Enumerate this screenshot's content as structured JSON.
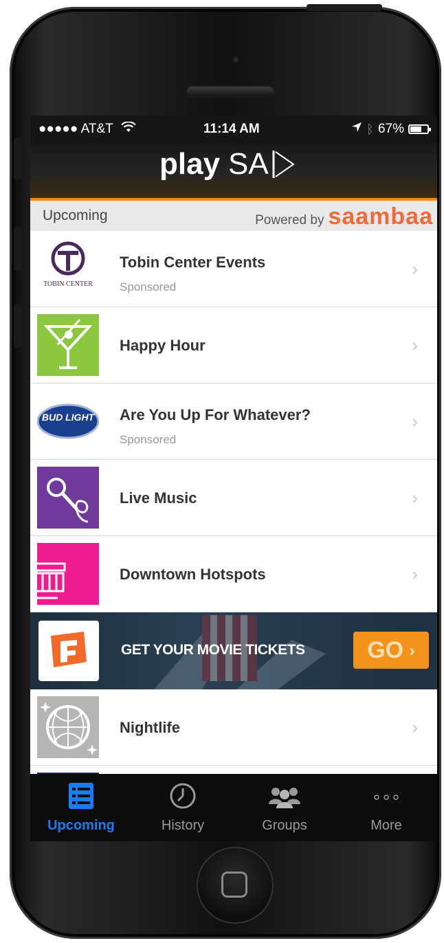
{
  "status_bar": {
    "carrier": "●●●●● AT&T",
    "time": "11:14 AM",
    "battery": "67%",
    "battery_level": 0.67
  },
  "header": {
    "logo_play": "play",
    "logo_sa": "SA"
  },
  "subheader": {
    "section": "Upcoming",
    "powered_by": "Powered by",
    "brand": "saambaa",
    "brand_color": "#f26a3a"
  },
  "list": [
    {
      "title": "Tobin Center Events",
      "subtitle": "Sponsored",
      "icon": "tobin-center-logo",
      "thumb_text": "TOBIN CENTER"
    },
    {
      "title": "Happy Hour",
      "subtitle": "",
      "icon": "martini-icon"
    },
    {
      "title": "Are You Up For Whatever?",
      "subtitle": "Sponsored",
      "icon": "bud-light-logo",
      "thumb_text": "BUD LIGHT"
    },
    {
      "title": "Live Music",
      "subtitle": "",
      "icon": "microphone-icon"
    },
    {
      "title": "Downtown Hotspots",
      "subtitle": "",
      "icon": "building-icon"
    }
  ],
  "banner": {
    "text": "GET YOUR MOVIE TICKETS",
    "button": "GO",
    "icon": "fandango-logo"
  },
  "list_after": [
    {
      "title": "Nightlife",
      "subtitle": "",
      "icon": "disco-ball-icon"
    }
  ],
  "tabs": [
    {
      "label": "Upcoming",
      "icon": "list-icon",
      "active": true
    },
    {
      "label": "History",
      "icon": "clock-icon",
      "active": false
    },
    {
      "label": "Groups",
      "icon": "people-icon",
      "active": false
    },
    {
      "label": "More",
      "icon": "more-icon",
      "active": false
    }
  ],
  "colors": {
    "accent_orange": "#f28a12",
    "tab_active": "#1a7cf5"
  }
}
